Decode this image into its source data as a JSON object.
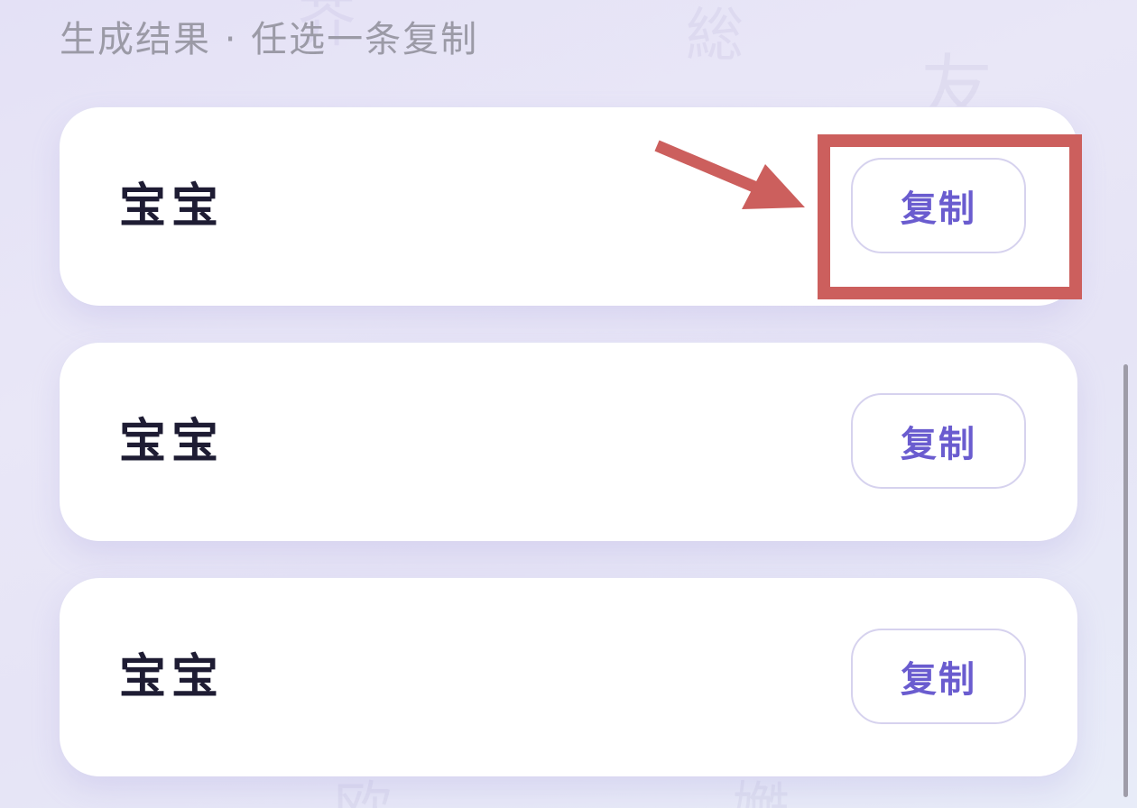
{
  "section": {
    "title": "生成结果 · 任选一条复制"
  },
  "results": [
    {
      "text": "宝宝",
      "copy_label": "复制"
    },
    {
      "text": "宝宝",
      "copy_label": "复制"
    },
    {
      "text": "宝宝",
      "copy_label": "复制"
    }
  ],
  "background_watermarks": [
    "総",
    "友",
    "芥",
    "欧",
    "嬔"
  ],
  "colors": {
    "accent": "#6a5ccf",
    "annotation": "#cc5f5d",
    "text_primary": "#1e1c33",
    "text_secondary": "#9b9aa6"
  }
}
